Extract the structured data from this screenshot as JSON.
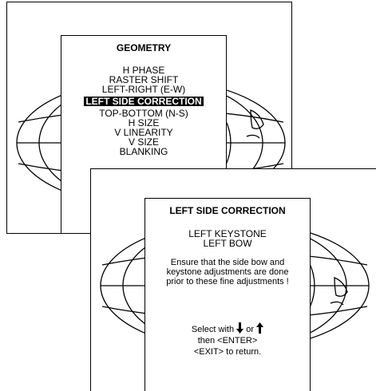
{
  "geometry_menu": {
    "title": "GEOMETRY",
    "items": [
      {
        "label": "H PHASE"
      },
      {
        "label": "RASTER SHIFT"
      },
      {
        "label": "LEFT-RIGHT (E-W)"
      },
      {
        "label": "LEFT SIDE CORRECTION",
        "selected": true
      },
      {
        "label": "TOP-BOTTOM (N-S)"
      },
      {
        "label": "H SIZE"
      },
      {
        "label": "V LINEARITY"
      },
      {
        "label": "V SIZE"
      },
      {
        "label": "BLANKING"
      }
    ]
  },
  "correction_menu": {
    "title": "LEFT SIDE CORRECTION",
    "items": [
      {
        "label": "LEFT KEYSTONE"
      },
      {
        "label": "LEFT BOW"
      }
    ],
    "note_lines": [
      "Ensure that the side bow and",
      "keystone adjustments are done",
      "prior to these fine adjustments !"
    ],
    "help": {
      "select_prefix": "Select with",
      "or_text": "or",
      "enter_line": "then <ENTER>",
      "exit_line": "<EXIT> to return."
    }
  },
  "icons": {
    "down": "arrow-down-icon",
    "up": "arrow-up-icon"
  }
}
